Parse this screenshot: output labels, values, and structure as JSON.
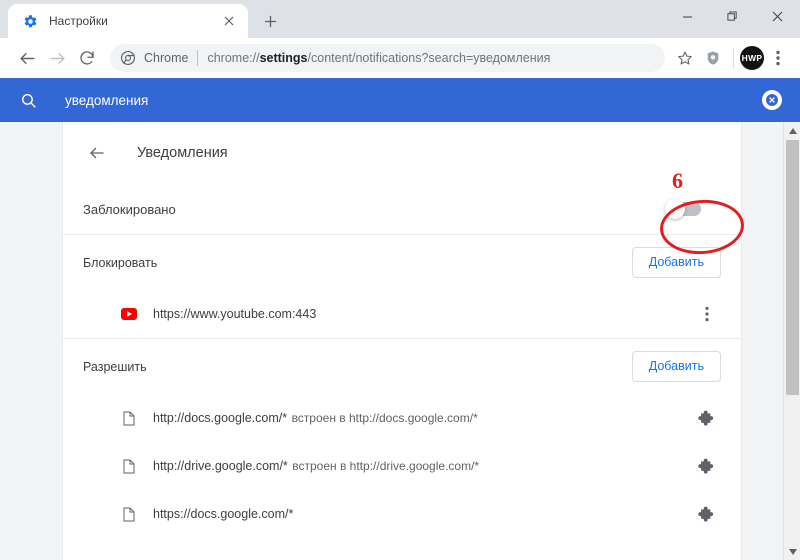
{
  "window": {
    "controls": {
      "minimize": "minimize-button",
      "restore": "restore-button",
      "close": "close-button"
    }
  },
  "tabstrip": {
    "tab": {
      "title": "Настройки",
      "favicon": "gear-icon",
      "close_label": "✕"
    },
    "new_tab_label": "+"
  },
  "toolbar": {
    "back": "←",
    "forward": "→",
    "reload": "⟳",
    "omnibox": {
      "security_icon": "chrome-logo-icon",
      "chip": "Chrome",
      "url_prefix": "chrome://",
      "url_bold": "settings",
      "url_suffix": "/content/notifications?search=уведомления"
    },
    "bookmark_icon": "star-icon",
    "shield_icon": "shield-icon",
    "avatar_initials": "HWP",
    "menu_icon": "three-dots-icon"
  },
  "search_banner": {
    "icon": "search-icon",
    "query": "уведомления",
    "clear_label": "✕",
    "background": "#3367d6"
  },
  "settings": {
    "back_label": "←",
    "title": "Уведомления",
    "toggle": {
      "label": "Заблокировано",
      "state": "off"
    },
    "sections": [
      {
        "id": "block",
        "label": "Блокировать",
        "add_label": "Добавить",
        "rows": [
          {
            "favicon": "youtube-icon",
            "primary": "https://www.youtube.com:443",
            "secondary": "",
            "action_icon": "three-dots-icon"
          }
        ]
      },
      {
        "id": "allow",
        "label": "Разрешить",
        "add_label": "Добавить",
        "rows": [
          {
            "favicon": "page-icon",
            "primary": "http://docs.google.com/*",
            "secondary": "встроен в http://docs.google.com/*",
            "action_icon": "puzzle-piece-icon"
          },
          {
            "favicon": "page-icon",
            "primary": "http://drive.google.com/*",
            "secondary": "встроен в http://drive.google.com/*",
            "action_icon": "puzzle-piece-icon"
          },
          {
            "favicon": "page-icon",
            "primary": "https://docs.google.com/*",
            "secondary": "",
            "action_icon": "puzzle-piece-icon"
          }
        ]
      }
    ]
  },
  "annotation": {
    "number": "6",
    "color": "#e02020",
    "shape": "ellipse-around-toggle"
  },
  "scrollbar": {
    "up_arrow": "▲",
    "down_arrow": "▼"
  }
}
